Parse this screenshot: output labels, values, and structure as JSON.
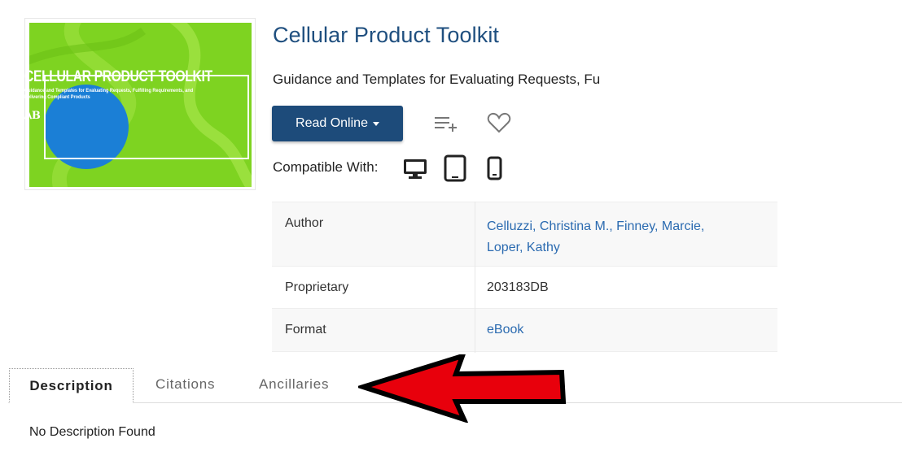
{
  "product": {
    "title": "Cellular Product Toolkit",
    "subtitle": "Guidance and Templates for Evaluating Requests, Fu"
  },
  "cover": {
    "title": "CELLULAR PRODUCT TOOLKIT",
    "subtitle": "Guidance and Templates for Evaluating Requests, Fulfilling Requirements, and Delivering Compliant Products",
    "logo": "ꓥB",
    "background_color": "#7ed321"
  },
  "actions": {
    "read_online": "Read Online",
    "add_to_list_icon": "playlist-add-icon",
    "favorite_icon": "heart-icon"
  },
  "compatibility": {
    "label": "Compatible With:",
    "devices": [
      "desktop-icon",
      "tablet-icon",
      "phone-icon"
    ]
  },
  "details": {
    "author_label": "Author",
    "authors": [
      "Celluzzi, Christina M.",
      "Finney, Marcie",
      "Loper, Kathy"
    ],
    "author_sep": ",",
    "proprietary_label": "Proprietary",
    "proprietary_value": "203183DB",
    "format_label": "Format",
    "format_value": "eBook"
  },
  "tabs": {
    "description": "Description",
    "citations": "Citations",
    "ancillaries": "Ancillaries"
  },
  "description_text": "No Description Found",
  "colors": {
    "accent": "#1d4b7a",
    "link": "#2a6ab0",
    "annotation_arrow": "#e8000c"
  }
}
